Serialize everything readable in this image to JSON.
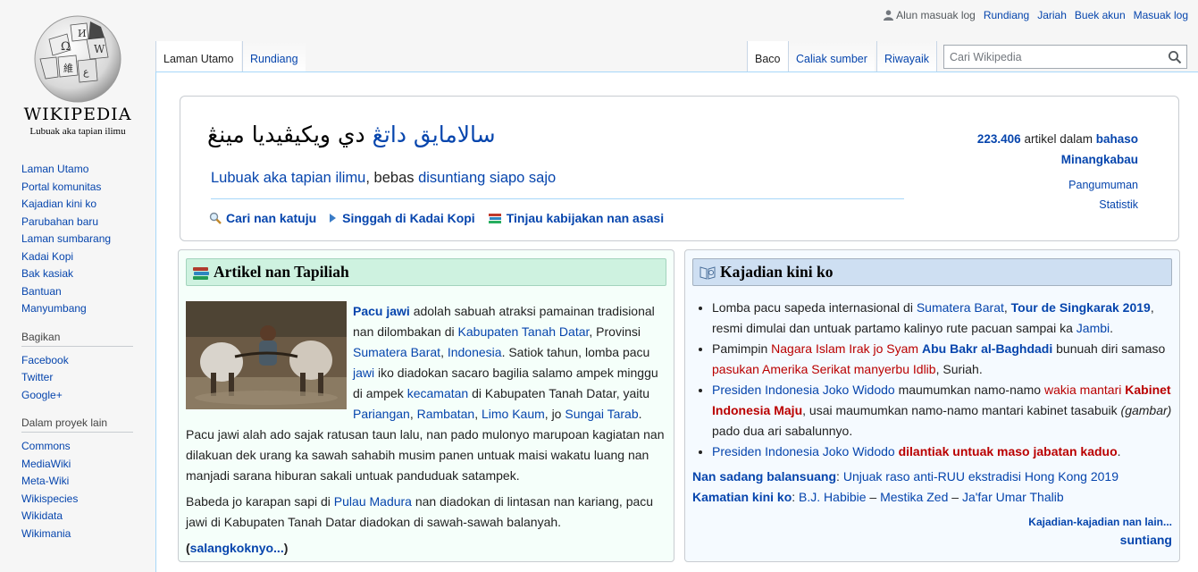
{
  "logo": {
    "wordmark": "WIKIPEDIA",
    "tagline": "Lubuak aka tapian ilimu"
  },
  "personal_tools": {
    "not_logged_in": "Alun masuak log",
    "talk": "Rundiang",
    "contributions": "Jariah",
    "create_account": "Buek akun",
    "log_in": "Masuak log"
  },
  "tabs_left": [
    {
      "label": "Laman Utamo",
      "selected": true
    },
    {
      "label": "Rundiang",
      "selected": false
    }
  ],
  "tabs_right": [
    {
      "label": "Baco",
      "selected": true
    },
    {
      "label": "Caliak sumber",
      "selected": false
    },
    {
      "label": "Riwayaik",
      "selected": false
    }
  ],
  "search": {
    "placeholder": "Cari Wikipedia"
  },
  "sidebar": {
    "navigation": [
      "Laman Utamo",
      "Portal komunitas",
      "Kajadian kini ko",
      "Parubahan baru",
      "Laman sumbarang",
      "Kadai Kopi",
      "Bak kasiak",
      "Bantuan",
      "Manyumbang"
    ],
    "share_heading": "Bagikan",
    "share": [
      "Facebook",
      "Twitter",
      "Google+"
    ],
    "projects_heading": "Dalam proyek lain",
    "projects": [
      "Commons",
      "MediaWiki",
      "Meta-Wiki",
      "Wikispecies",
      "Wikidata",
      "Wikimania"
    ]
  },
  "welcome": {
    "title_part1": "سالامايق داتڠ",
    "title_part2": "دي ويكيڤيديا مينڠ",
    "sub_link1": "Lubuak aka tapian ilimu",
    "sub_text": ", bebas ",
    "sub_link2": "disuntiang siapo sajo",
    "links": [
      "Cari nan katuju",
      "Singgah di Kadai Kopi",
      "Tinjau kabijakan nan asasi"
    ],
    "article_count": "223.406",
    "count_text": " artikel dalam ",
    "count_lang1": "bahaso",
    "count_lang2": "Minangkabau",
    "announcements": "Pangumuman",
    "statistics": "Statistik"
  },
  "featured": {
    "heading": "Artikel nan Tapiliah",
    "p1": [
      {
        "t": "Pacu jawi",
        "k": "lb"
      },
      {
        "t": " adolah sabuah atraksi pamainan tradisional nan dilombakan di ",
        "k": "t"
      },
      {
        "t": "Kabupaten Tanah Datar",
        "k": "l"
      },
      {
        "t": ", Provinsi ",
        "k": "t"
      },
      {
        "t": "Sumatera Barat",
        "k": "l"
      },
      {
        "t": ", ",
        "k": "t"
      },
      {
        "t": "Indonesia",
        "k": "l"
      },
      {
        "t": ". Satiok tahun, lomba pacu ",
        "k": "t"
      },
      {
        "t": "jawi",
        "k": "l"
      },
      {
        "t": " iko diadokan sacaro bagilia salamo ampek minggu di ampek ",
        "k": "t"
      },
      {
        "t": "kecamatan",
        "k": "l"
      },
      {
        "t": " di Kabupaten Tanah Datar, yaitu ",
        "k": "t"
      },
      {
        "t": "Pariangan",
        "k": "l"
      },
      {
        "t": ", ",
        "k": "t"
      },
      {
        "t": "Rambatan",
        "k": "l"
      },
      {
        "t": ", ",
        "k": "t"
      },
      {
        "t": "Limo Kaum",
        "k": "l"
      },
      {
        "t": ", jo ",
        "k": "t"
      },
      {
        "t": "Sungai Tarab",
        "k": "l"
      },
      {
        "t": ". Pacu jawi alah ado sajak ratusan taun lalu, nan pado mulonyo marupoan kagiatan nan dilakuan dek urang ka sawah sahabih musim panen untuak maisi wakatu luang nan manjadi sarana hiburan sakali untuak panduduak satampek.",
        "k": "t"
      }
    ],
    "p2": [
      {
        "t": "Babeda jo karapan sapi di ",
        "k": "t"
      },
      {
        "t": "Pulau Madura",
        "k": "l"
      },
      {
        "t": " nan diadokan di lintasan nan kariang, pacu jawi di Kabupaten Tanah Datar diadokan di sawah-sawah balanyah.",
        "k": "t"
      }
    ],
    "more_open": "(",
    "more_link": "salangkoknyo...",
    "more_close": ")"
  },
  "news": {
    "heading": "Kajadian kini ko",
    "items": [
      [
        {
          "t": "Lomba pacu sapeda internasional di ",
          "k": "t"
        },
        {
          "t": "Sumatera Barat",
          "k": "l"
        },
        {
          "t": ", ",
          "k": "t"
        },
        {
          "t": "Tour de Singkarak 2019",
          "k": "lb"
        },
        {
          "t": ", resmi dimulai dan untuak partamo kalinyo rute pacuan sampai ka ",
          "k": "t"
        },
        {
          "t": "Jambi",
          "k": "l"
        },
        {
          "t": ".",
          "k": "t"
        }
      ],
      [
        {
          "t": "Pamimpin ",
          "k": "t"
        },
        {
          "t": "Nagara Islam Irak jo Syam",
          "k": "r"
        },
        {
          "t": " ",
          "k": "t"
        },
        {
          "t": "Abu Bakr al-Baghdadi",
          "k": "lb"
        },
        {
          "t": " bunuah diri samaso ",
          "k": "t"
        },
        {
          "t": "pasukan Amerika Serikat manyerbu Idlib",
          "k": "r"
        },
        {
          "t": ", Suriah.",
          "k": "t"
        }
      ],
      [
        {
          "t": "Presiden Indonesia Joko Widodo",
          "k": "l"
        },
        {
          "t": " maumumkan namo-namo ",
          "k": "t"
        },
        {
          "t": "wakia mantari",
          "k": "r"
        },
        {
          "t": " ",
          "k": "t"
        },
        {
          "t": "Kabinet Indonesia Maju",
          "k": "rb"
        },
        {
          "t": ", usai maumumkan namo-namo mantari kabinet tasabuik ",
          "k": "t"
        },
        {
          "t": "(gambar)",
          "k": "i"
        },
        {
          "t": " pado dua ari sabalunnyo.",
          "k": "t"
        }
      ],
      [
        {
          "t": "Presiden Indonesia Joko Widodo",
          "k": "l"
        },
        {
          "t": " ",
          "k": "t"
        },
        {
          "t": "dilantiak untuak maso jabatan kaduo",
          "k": "rb"
        },
        {
          "t": ".",
          "k": "t"
        }
      ]
    ],
    "ongoing": [
      {
        "t": "Nan sadang balansuang",
        "k": "lb"
      },
      {
        "t": ": ",
        "k": "t"
      },
      {
        "t": "Unjuak raso anti-RUU ekstradisi Hong Kong 2019",
        "k": "l"
      }
    ],
    "deaths": [
      {
        "t": "Kamatian kini ko",
        "k": "lb"
      },
      {
        "t": ": ",
        "k": "t"
      },
      {
        "t": "B.J. Habibie",
        "k": "l"
      },
      {
        "t": " – ",
        "k": "t"
      },
      {
        "t": "Mestika Zed",
        "k": "l"
      },
      {
        "t": " – ",
        "k": "t"
      },
      {
        "t": "Ja'far Umar Thalib",
        "k": "l"
      }
    ],
    "more_link": "Kajadian-kajadian nan lain...",
    "edit_link": "suntiang"
  }
}
